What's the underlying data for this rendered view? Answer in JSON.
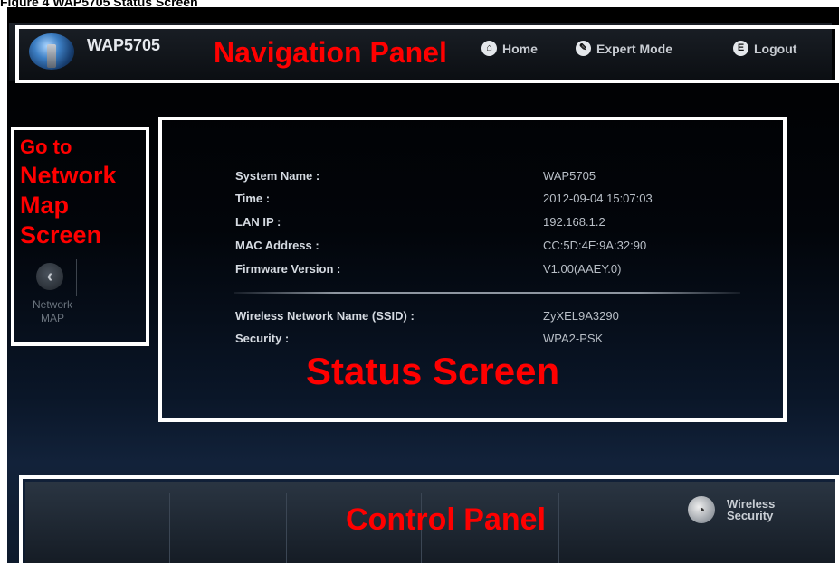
{
  "caption": "Figure 4 WAP5705 Status Screen",
  "nav": {
    "model": "WAP5705",
    "home": "Home",
    "expert_mode": "Expert Mode",
    "logout": "Logout"
  },
  "annotations": {
    "navigation_panel": "Navigation Panel",
    "go_to_network_map": [
      "Go to",
      "Network",
      "Map",
      "Screen"
    ],
    "status_screen": "Status Screen",
    "control_panel": "Control Panel"
  },
  "network_map": {
    "line1": "Network",
    "line2": "MAP"
  },
  "status": {
    "system_name_label": "System Name :",
    "system_name": "WAP5705",
    "time_label": "Time :",
    "time": "2012-09-04 15:07:03",
    "lan_ip_label": "LAN IP :",
    "lan_ip": "192.168.1.2",
    "mac_label": "MAC Address :",
    "mac": "CC:5D:4E:9A:32:90",
    "firmware_label": "Firmware Version :",
    "firmware": "V1.00(AAEY.0)",
    "ssid_label": "Wireless Network Name (SSID) :",
    "ssid": "ZyXEL9A3290",
    "security_label": "Security :",
    "security": "WPA2-PSK"
  },
  "control_panel": {
    "wireless_security_line1": "Wireless",
    "wireless_security_line2": "Security"
  },
  "colors": {
    "annotation_red": "#ff0000",
    "highlight_box": "#ffffff"
  }
}
